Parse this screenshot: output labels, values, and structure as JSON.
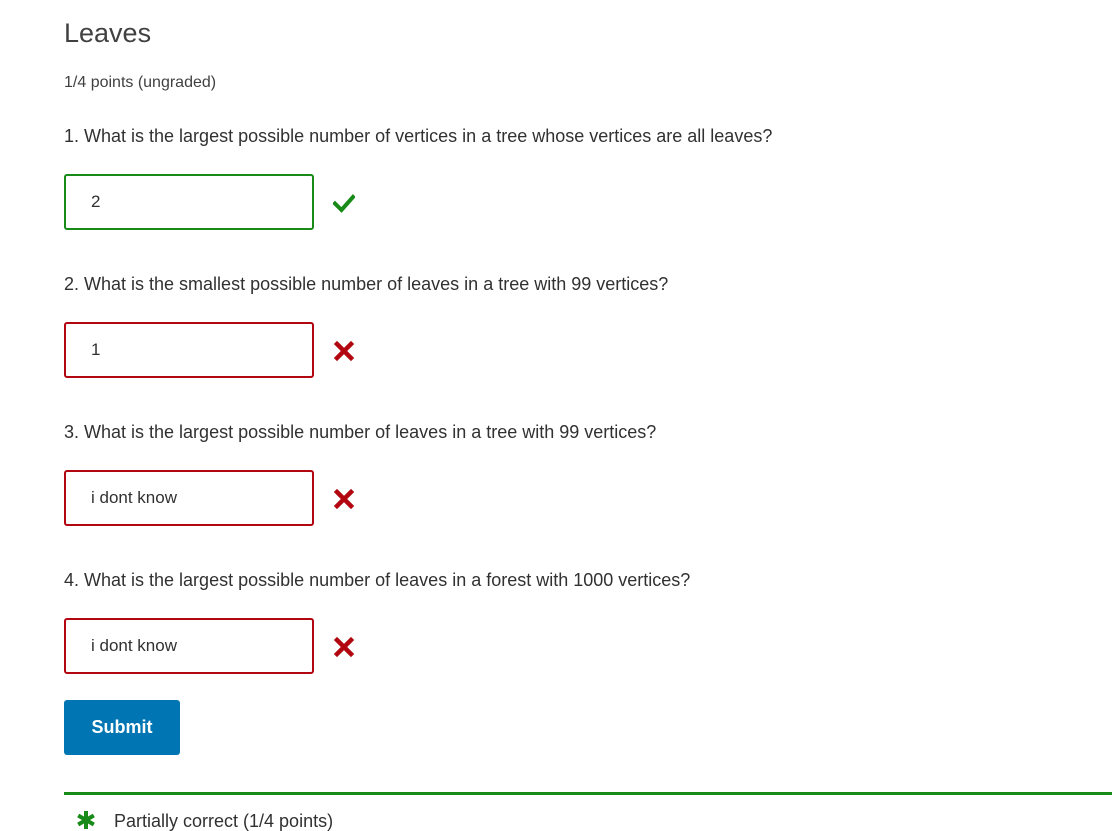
{
  "problem": {
    "title": "Leaves",
    "points": "1/4 points (ungraded)"
  },
  "questions": [
    {
      "text": "1. What is the largest possible number of vertices in a tree whose vertices are all leaves?",
      "answer": "2",
      "status": "correct",
      "icon": "checkmark-icon",
      "color": "#178a17"
    },
    {
      "text": "2. What is the smallest possible number of leaves in a tree with 99 vertices?",
      "answer": "1",
      "status": "incorrect",
      "icon": "x-icon",
      "color": "#b20610"
    },
    {
      "text": "3. What is the largest possible number of leaves in a tree with 99 vertices?",
      "answer": "i dont know",
      "status": "incorrect",
      "icon": "x-icon",
      "color": "#b20610"
    },
    {
      "text": "4. What is the largest possible number of leaves in a forest with 1000 vertices?",
      "answer": "i dont know",
      "status": "incorrect",
      "icon": "x-icon",
      "color": "#b20610"
    }
  ],
  "submit": {
    "label": "Submit",
    "color": "#0075b4"
  },
  "feedback": {
    "text": "Partially correct (1/4 points)",
    "icon": "asterisk-icon",
    "color": "#178a17"
  }
}
